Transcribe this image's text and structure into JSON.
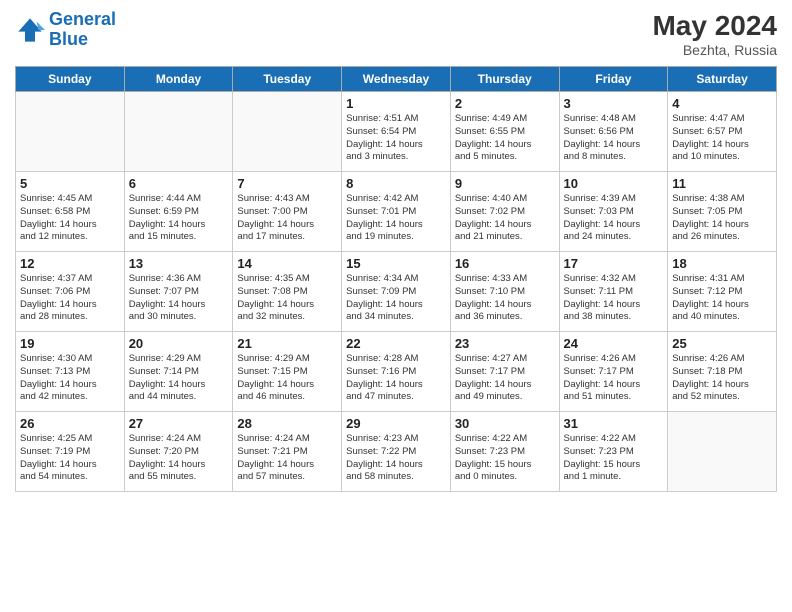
{
  "header": {
    "logo_line1": "General",
    "logo_line2": "Blue",
    "month_year": "May 2024",
    "location": "Bezhta, Russia"
  },
  "weekdays": [
    "Sunday",
    "Monday",
    "Tuesday",
    "Wednesday",
    "Thursday",
    "Friday",
    "Saturday"
  ],
  "weeks": [
    [
      {
        "day": "",
        "info": ""
      },
      {
        "day": "",
        "info": ""
      },
      {
        "day": "",
        "info": ""
      },
      {
        "day": "1",
        "info": "Sunrise: 4:51 AM\nSunset: 6:54 PM\nDaylight: 14 hours\nand 3 minutes."
      },
      {
        "day": "2",
        "info": "Sunrise: 4:49 AM\nSunset: 6:55 PM\nDaylight: 14 hours\nand 5 minutes."
      },
      {
        "day": "3",
        "info": "Sunrise: 4:48 AM\nSunset: 6:56 PM\nDaylight: 14 hours\nand 8 minutes."
      },
      {
        "day": "4",
        "info": "Sunrise: 4:47 AM\nSunset: 6:57 PM\nDaylight: 14 hours\nand 10 minutes."
      }
    ],
    [
      {
        "day": "5",
        "info": "Sunrise: 4:45 AM\nSunset: 6:58 PM\nDaylight: 14 hours\nand 12 minutes."
      },
      {
        "day": "6",
        "info": "Sunrise: 4:44 AM\nSunset: 6:59 PM\nDaylight: 14 hours\nand 15 minutes."
      },
      {
        "day": "7",
        "info": "Sunrise: 4:43 AM\nSunset: 7:00 PM\nDaylight: 14 hours\nand 17 minutes."
      },
      {
        "day": "8",
        "info": "Sunrise: 4:42 AM\nSunset: 7:01 PM\nDaylight: 14 hours\nand 19 minutes."
      },
      {
        "day": "9",
        "info": "Sunrise: 4:40 AM\nSunset: 7:02 PM\nDaylight: 14 hours\nand 21 minutes."
      },
      {
        "day": "10",
        "info": "Sunrise: 4:39 AM\nSunset: 7:03 PM\nDaylight: 14 hours\nand 24 minutes."
      },
      {
        "day": "11",
        "info": "Sunrise: 4:38 AM\nSunset: 7:05 PM\nDaylight: 14 hours\nand 26 minutes."
      }
    ],
    [
      {
        "day": "12",
        "info": "Sunrise: 4:37 AM\nSunset: 7:06 PM\nDaylight: 14 hours\nand 28 minutes."
      },
      {
        "day": "13",
        "info": "Sunrise: 4:36 AM\nSunset: 7:07 PM\nDaylight: 14 hours\nand 30 minutes."
      },
      {
        "day": "14",
        "info": "Sunrise: 4:35 AM\nSunset: 7:08 PM\nDaylight: 14 hours\nand 32 minutes."
      },
      {
        "day": "15",
        "info": "Sunrise: 4:34 AM\nSunset: 7:09 PM\nDaylight: 14 hours\nand 34 minutes."
      },
      {
        "day": "16",
        "info": "Sunrise: 4:33 AM\nSunset: 7:10 PM\nDaylight: 14 hours\nand 36 minutes."
      },
      {
        "day": "17",
        "info": "Sunrise: 4:32 AM\nSunset: 7:11 PM\nDaylight: 14 hours\nand 38 minutes."
      },
      {
        "day": "18",
        "info": "Sunrise: 4:31 AM\nSunset: 7:12 PM\nDaylight: 14 hours\nand 40 minutes."
      }
    ],
    [
      {
        "day": "19",
        "info": "Sunrise: 4:30 AM\nSunset: 7:13 PM\nDaylight: 14 hours\nand 42 minutes."
      },
      {
        "day": "20",
        "info": "Sunrise: 4:29 AM\nSunset: 7:14 PM\nDaylight: 14 hours\nand 44 minutes."
      },
      {
        "day": "21",
        "info": "Sunrise: 4:29 AM\nSunset: 7:15 PM\nDaylight: 14 hours\nand 46 minutes."
      },
      {
        "day": "22",
        "info": "Sunrise: 4:28 AM\nSunset: 7:16 PM\nDaylight: 14 hours\nand 47 minutes."
      },
      {
        "day": "23",
        "info": "Sunrise: 4:27 AM\nSunset: 7:17 PM\nDaylight: 14 hours\nand 49 minutes."
      },
      {
        "day": "24",
        "info": "Sunrise: 4:26 AM\nSunset: 7:17 PM\nDaylight: 14 hours\nand 51 minutes."
      },
      {
        "day": "25",
        "info": "Sunrise: 4:26 AM\nSunset: 7:18 PM\nDaylight: 14 hours\nand 52 minutes."
      }
    ],
    [
      {
        "day": "26",
        "info": "Sunrise: 4:25 AM\nSunset: 7:19 PM\nDaylight: 14 hours\nand 54 minutes."
      },
      {
        "day": "27",
        "info": "Sunrise: 4:24 AM\nSunset: 7:20 PM\nDaylight: 14 hours\nand 55 minutes."
      },
      {
        "day": "28",
        "info": "Sunrise: 4:24 AM\nSunset: 7:21 PM\nDaylight: 14 hours\nand 57 minutes."
      },
      {
        "day": "29",
        "info": "Sunrise: 4:23 AM\nSunset: 7:22 PM\nDaylight: 14 hours\nand 58 minutes."
      },
      {
        "day": "30",
        "info": "Sunrise: 4:22 AM\nSunset: 7:23 PM\nDaylight: 15 hours\nand 0 minutes."
      },
      {
        "day": "31",
        "info": "Sunrise: 4:22 AM\nSunset: 7:23 PM\nDaylight: 15 hours\nand 1 minute."
      },
      {
        "day": "",
        "info": ""
      }
    ]
  ]
}
